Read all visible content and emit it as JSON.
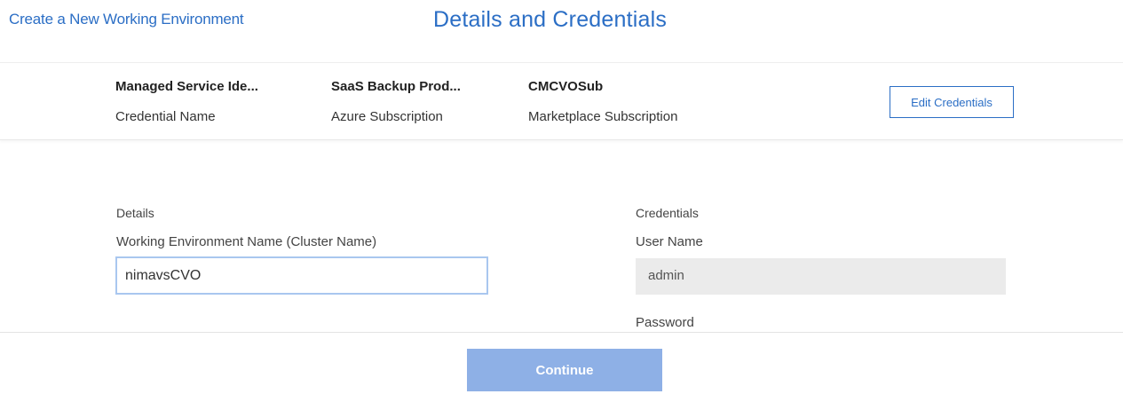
{
  "header": {
    "back_link": "Create a New Working Environment",
    "title": "Details and Credentials"
  },
  "credentials_bar": {
    "items": [
      {
        "value": "Managed Service Ide...",
        "label": "Credential Name"
      },
      {
        "value": "SaaS Backup Prod...",
        "label": "Azure Subscription"
      },
      {
        "value": "CMCVOSub",
        "label": "Marketplace Subscription"
      }
    ],
    "edit_button": "Edit Credentials"
  },
  "details": {
    "section_title": "Details",
    "cluster_name_label": "Working Environment Name (Cluster Name)",
    "cluster_name_value": "nimavsCVO"
  },
  "credentials": {
    "section_title": "Credentials",
    "user_name_label": "User Name",
    "user_name_value": "admin",
    "password_label": "Password"
  },
  "footer": {
    "continue_label": "Continue"
  },
  "colors": {
    "accent": "#2b6ec5",
    "continue_disabled": "#8eb0e6",
    "readonly_field": "#ebebeb"
  }
}
